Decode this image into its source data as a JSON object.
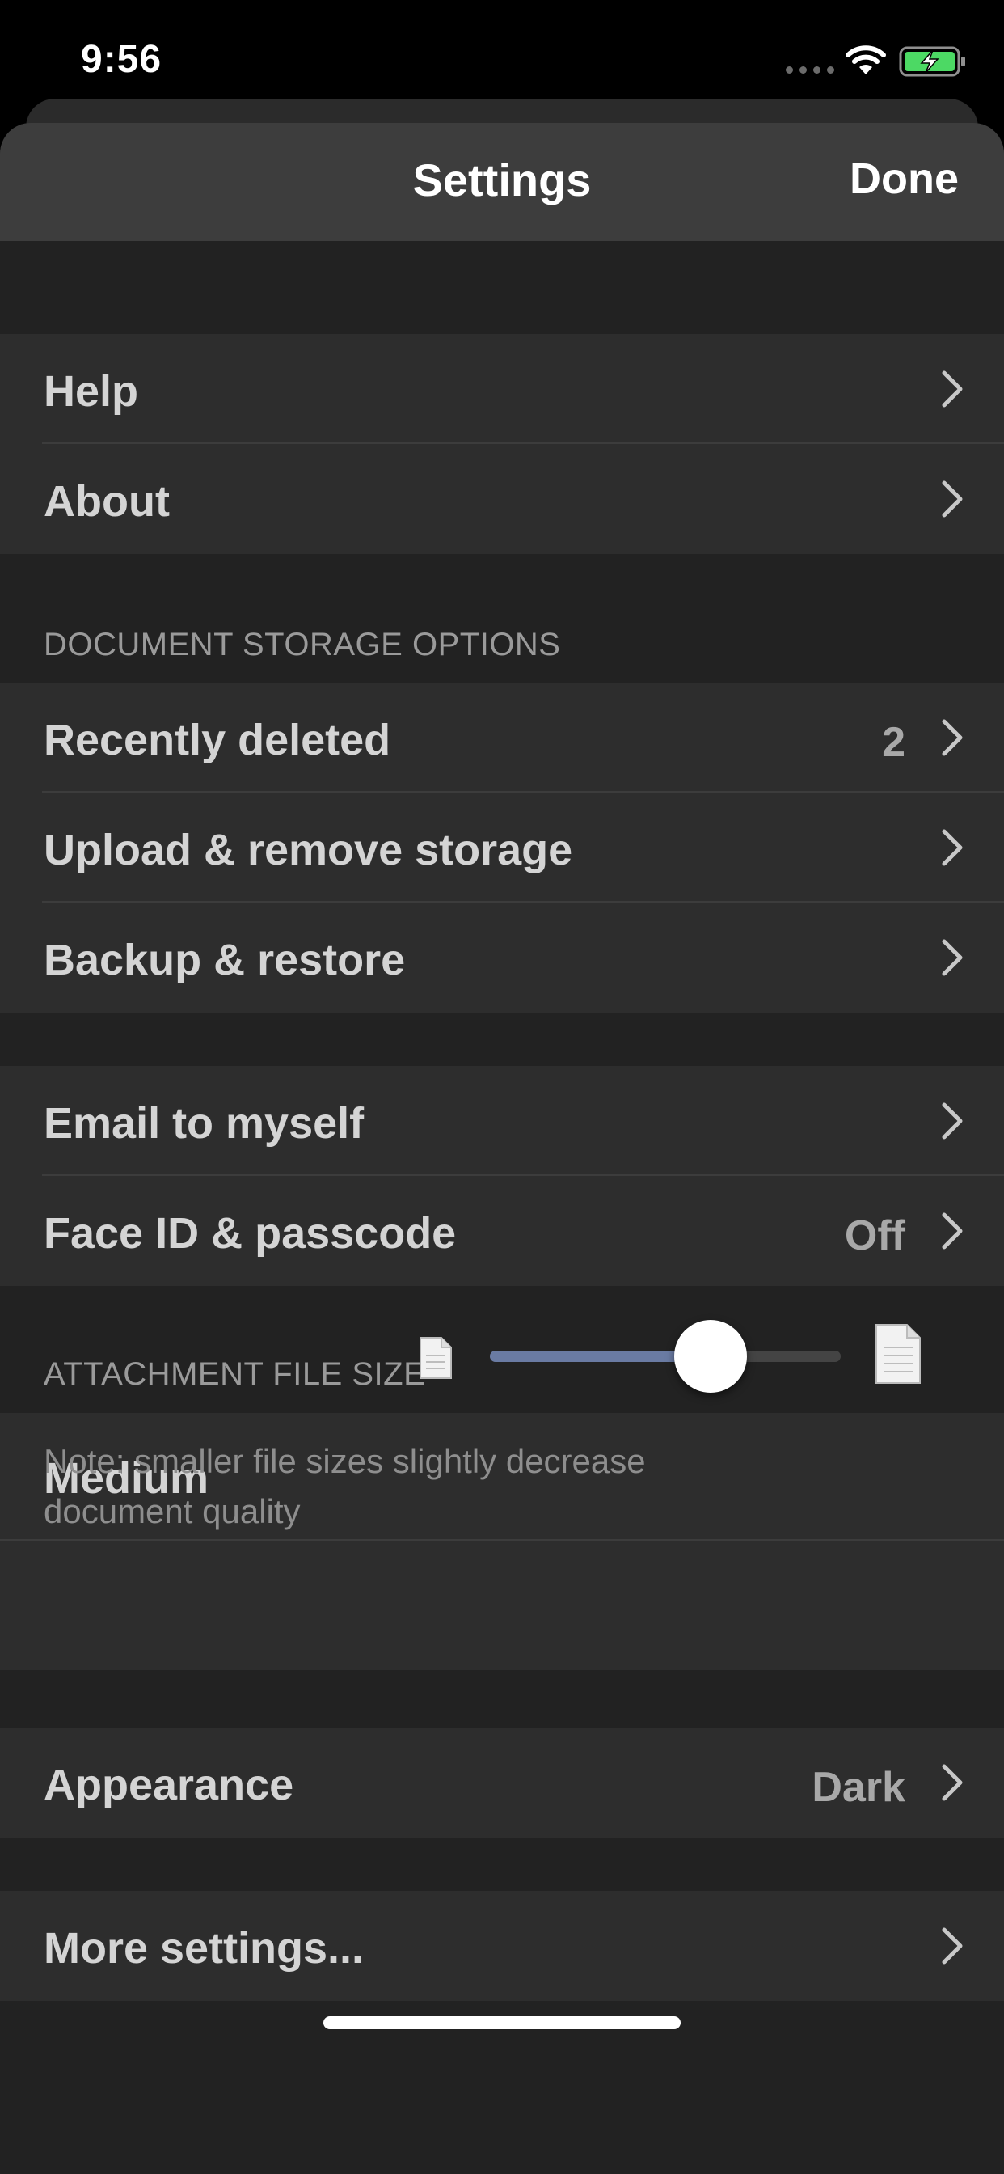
{
  "status_bar": {
    "time": "9:56"
  },
  "nav": {
    "title": "Settings",
    "done_label": "Done"
  },
  "group1": {
    "help_label": "Help",
    "about_label": "About"
  },
  "document_storage": {
    "header": "DOCUMENT STORAGE OPTIONS",
    "recently_deleted_label": "Recently deleted",
    "recently_deleted_count": "2",
    "upload_label": "Upload & remove storage",
    "backup_label": "Backup & restore"
  },
  "group3": {
    "email_label": "Email to myself",
    "faceid_label": "Face ID & passcode",
    "faceid_value": "Off"
  },
  "attachment": {
    "header": "ATTACHMENT FILE SIZE",
    "size_label": "Medium",
    "slider_fraction": 0.63,
    "note": "Note: smaller file sizes slightly decrease document quality"
  },
  "appearance": {
    "label": "Appearance",
    "value": "Dark"
  },
  "more": {
    "label": "More settings..."
  },
  "colors": {
    "background": "#222222",
    "row": "#2d2d2d",
    "nav": "#3d3d3d",
    "slider_fill": "#6a7ba3"
  }
}
